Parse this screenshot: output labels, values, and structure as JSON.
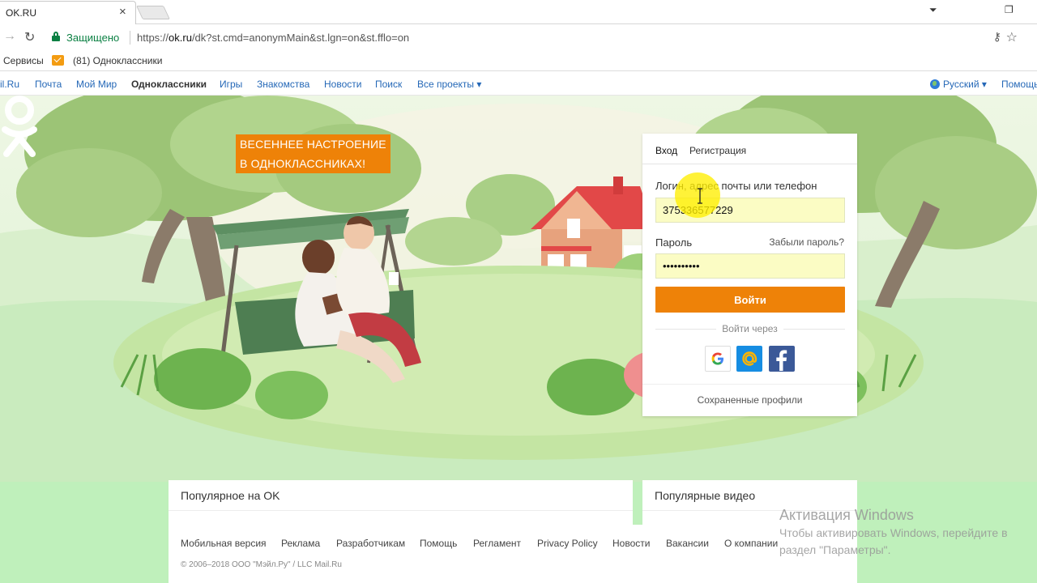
{
  "browser": {
    "tab_title": "OK.RU",
    "tab_close": "×",
    "win_buttons": [
      "⏷",
      "❐"
    ],
    "secure_label": "Защищено",
    "url_scheme": "https://",
    "url_host": "ok.ru",
    "url_path": "/dk?st.cmd=anonymMain&st.lgn=on&st.fflo=on",
    "back_glyph": "→",
    "reload_glyph": "↻",
    "key_glyph": "⚷",
    "star_glyph": "☆"
  },
  "bookmarks": {
    "apps_label": "Сервисы",
    "ok_label": "(81) Одноклассники"
  },
  "portal_nav": {
    "items": [
      "il.Ru",
      "Почта",
      "Мой Мир",
      "Одноклассники",
      "Игры",
      "Знакомства",
      "Новости",
      "Поиск",
      "Все проекты ▾"
    ],
    "language": "Русский ▾",
    "help": "Помощь"
  },
  "promo": {
    "line1": "ВЕСЕННЕЕ НАСТРОЕНИЕ",
    "line2": "В ОДНОКЛАССНИКАХ!"
  },
  "login": {
    "tab_login": "Вход",
    "tab_register": "Регистрация",
    "login_label": "Логин, адрес почты или телефон",
    "login_value": "375336577229",
    "password_label": "Пароль",
    "forgot_label": "Забыли пароль?",
    "password_value": "••••••••••",
    "submit_label": "Войти",
    "via_label": "Войти через",
    "saved_profiles": "Сохраненные профили"
  },
  "panels": {
    "popular_ok": "Популярное на OK",
    "popular_video": "Популярные видео"
  },
  "footer": {
    "links": [
      "Мобильная версия",
      "Реклама",
      "Разработчикам",
      "Помощь",
      "Регламент",
      "Privacy Policy",
      "Новости",
      "Вакансии",
      "О компании"
    ],
    "copyright": "© 2006–2018 ООО \"Мэйл.Ру\" / LLC Mail.Ru"
  },
  "watermark": {
    "title": "Активация Windows",
    "line1": "Чтобы активировать Windows, перейдите в",
    "line2": "раздел \"Параметры\"."
  },
  "colors": {
    "ok_orange": "#ee8208",
    "link_blue": "#2568b7",
    "secure_green": "#0b8043",
    "autofill_yellow": "#fbfcc4"
  }
}
